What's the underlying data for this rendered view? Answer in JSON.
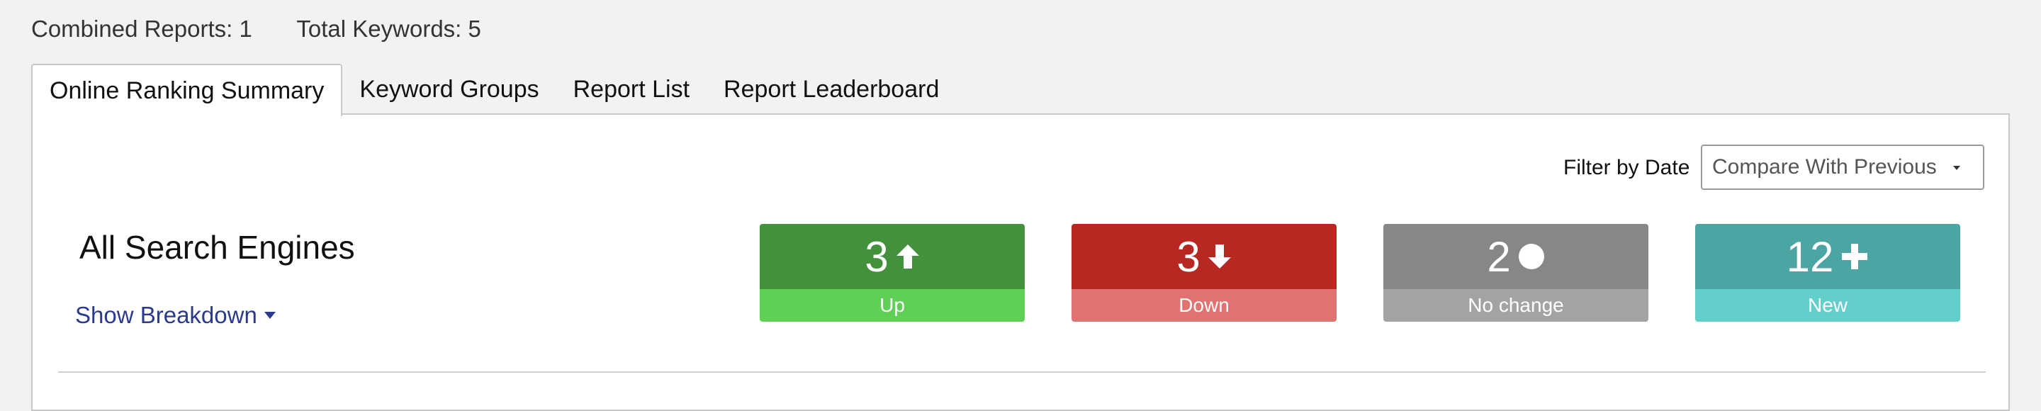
{
  "meta": {
    "combined_reports": "Combined Reports: 1",
    "total_keywords": "Total Keywords: 5"
  },
  "tabs": [
    {
      "label": "Online Ranking Summary",
      "active": true
    },
    {
      "label": "Keyword Groups",
      "active": false
    },
    {
      "label": "Report List",
      "active": false
    },
    {
      "label": "Report Leaderboard",
      "active": false
    }
  ],
  "filter": {
    "label": "Filter by Date",
    "selected": "Compare With Previous"
  },
  "engines": {
    "title": "All Search Engines",
    "breakdown_label": "Show Breakdown"
  },
  "stats": [
    {
      "value": "3",
      "label": "Up",
      "icon": "arrow-up-icon",
      "color_top": "#43913d",
      "color_bottom": "#5fcf55"
    },
    {
      "value": "3",
      "label": "Down",
      "icon": "arrow-down-icon",
      "color_top": "#b82722",
      "color_bottom": "#e17272"
    },
    {
      "value": "2",
      "label": "No change",
      "icon": "circle-icon",
      "color_top": "#878787",
      "color_bottom": "#a3a3a3"
    },
    {
      "value": "12",
      "label": "New",
      "icon": "plus-icon",
      "color_top": "#4ba5a3",
      "color_bottom": "#63cfca"
    }
  ]
}
